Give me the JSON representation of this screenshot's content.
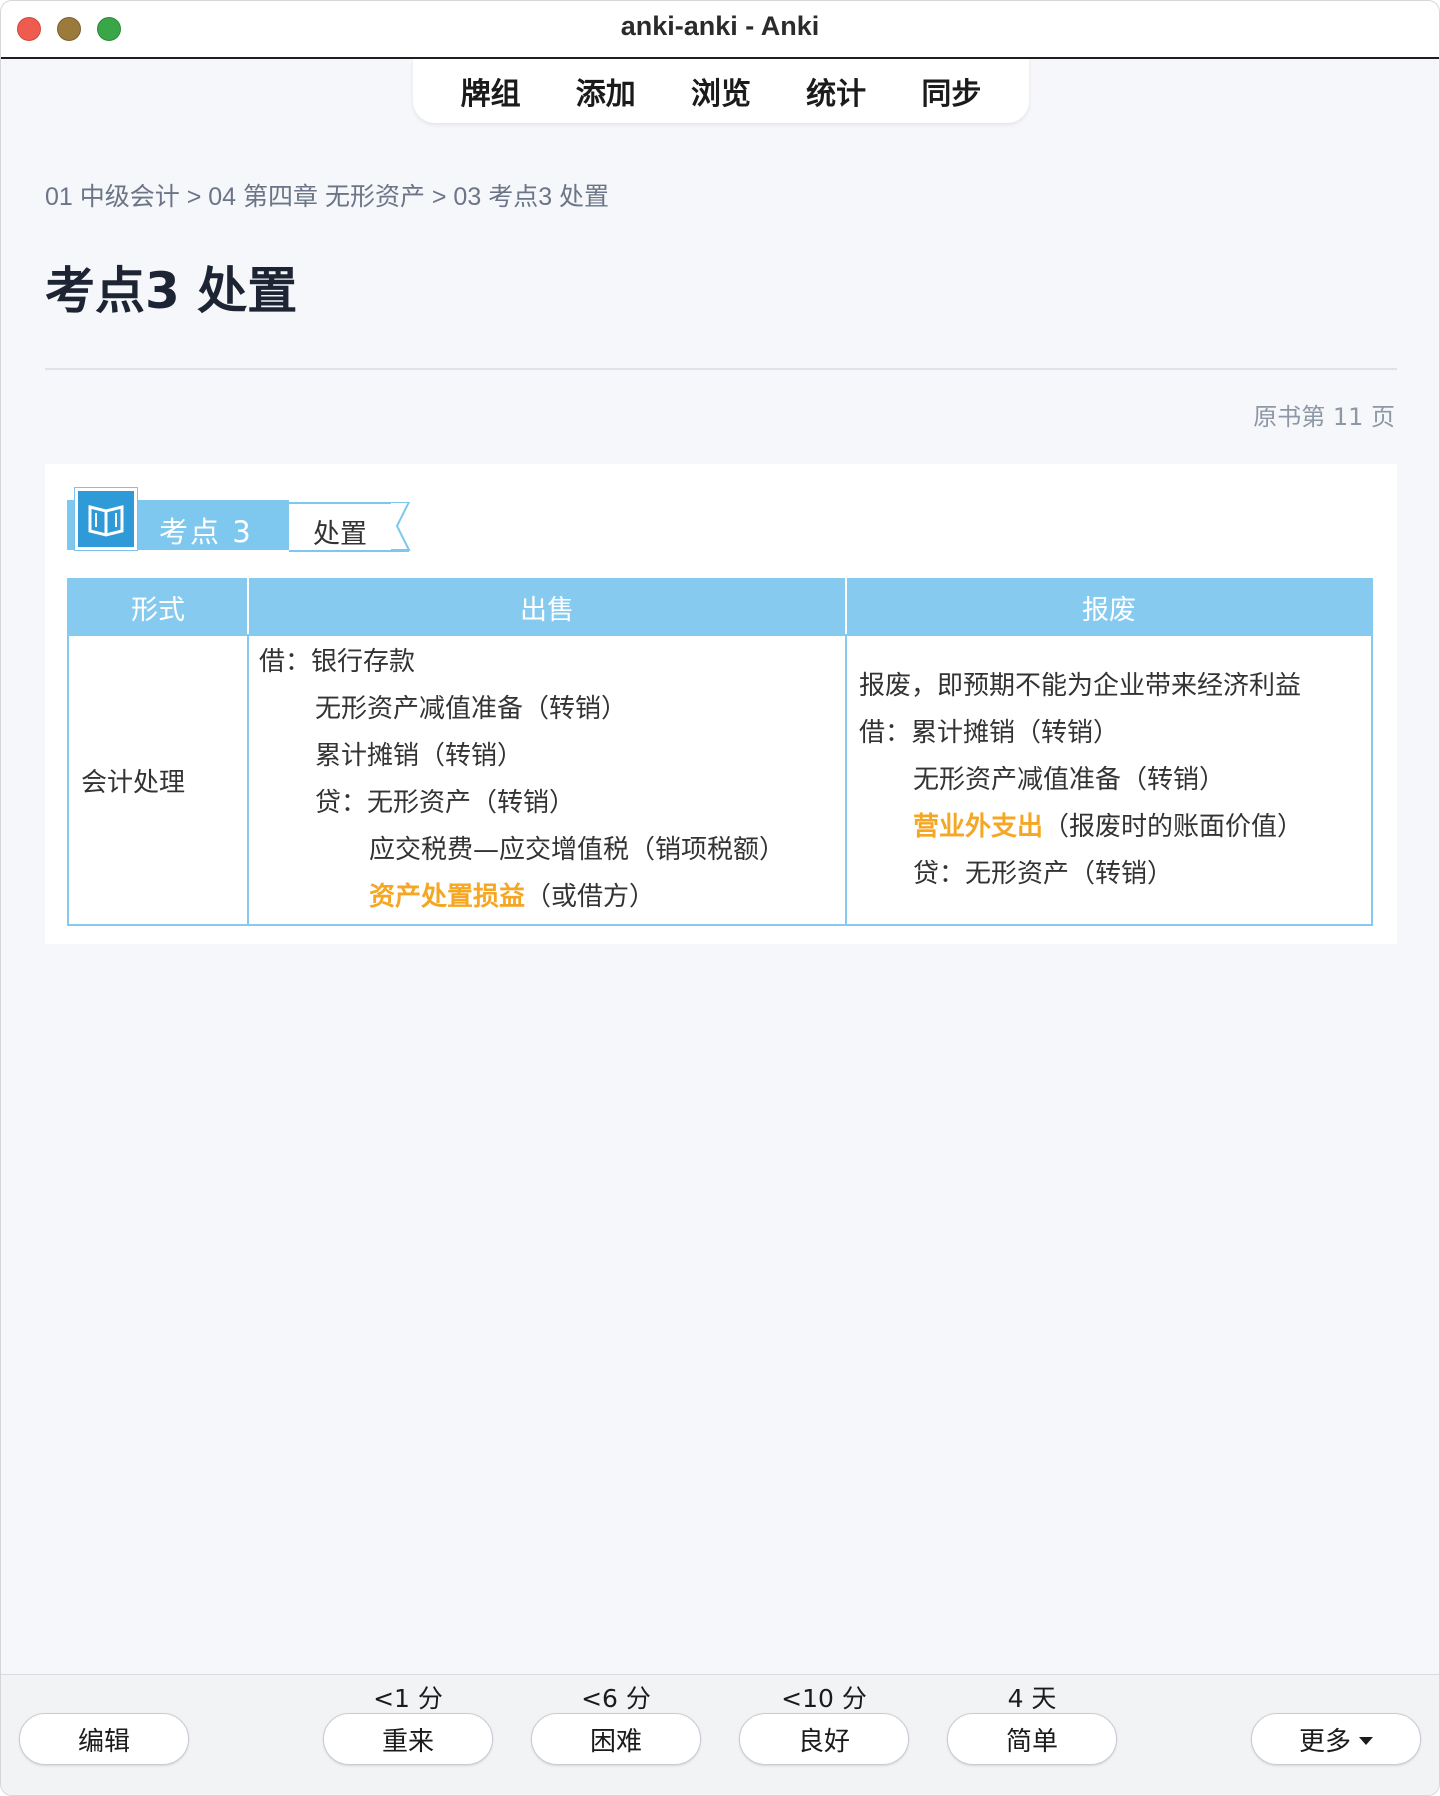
{
  "window": {
    "title": "anki-anki - Anki"
  },
  "topnav": {
    "items": [
      "牌组",
      "添加",
      "浏览",
      "统计",
      "同步"
    ]
  },
  "card": {
    "breadcrumb": "01 中级会计 > 04 第四章 无形资产 > 03 考点3 处置",
    "title": "考点3 处置",
    "page_ref": "原书第 11 页",
    "image": {
      "kp_label": "考点 3",
      "kp_tag": "处置",
      "table": {
        "headers": [
          "形式",
          "出售",
          "报废"
        ],
        "row_label": "会计处理",
        "sale_lines": [
          "借：银行存款",
          "无形资产减值准备（转销）",
          "累计摊销（转销）",
          "贷：无形资产（转销）",
          "应交税费—应交增值税（销项税额）",
          "资产处置损益",
          "（或借方）"
        ],
        "scrap_lines": [
          "报废，即预期不能为企业带来经济利益",
          "借：累计摊销（转销）",
          "无形资产减值准备（转销）",
          "营业外支出",
          "（报废时的账面价值）",
          "贷：无形资产（转销）"
        ]
      },
      "highlight_color": "#f5a623",
      "header_color": "#86cbef"
    }
  },
  "bottom": {
    "edit_label": "编辑",
    "more_label": "更多",
    "answers": [
      {
        "interval": "<1 分",
        "label": "重来"
      },
      {
        "interval": "<6 分",
        "label": "困难"
      },
      {
        "interval": "<10 分",
        "label": "良好"
      },
      {
        "interval": "4 天",
        "label": "简单"
      }
    ]
  }
}
